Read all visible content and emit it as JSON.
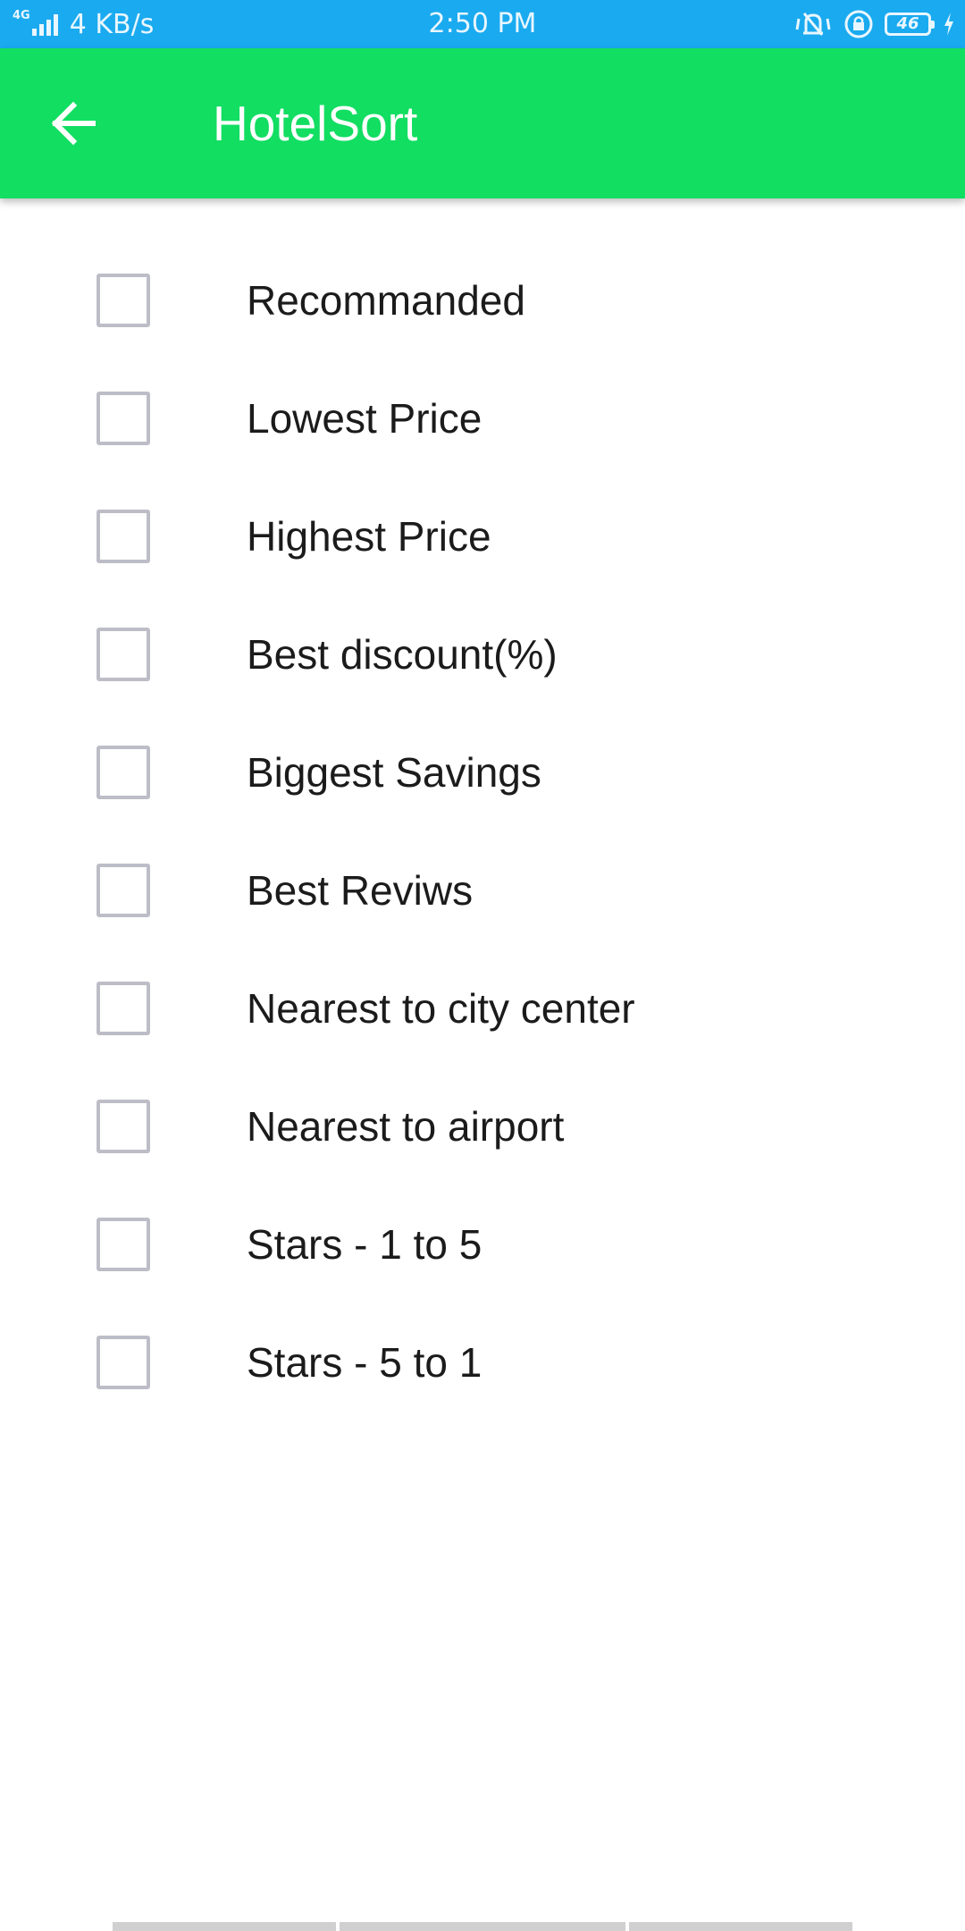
{
  "status_bar": {
    "network_type": "4G",
    "data_speed": "4 KB/s",
    "time": "2:50 PM",
    "battery_level": "46",
    "icons": [
      "signal-icon",
      "vibrate-icon",
      "rotation-lock-icon",
      "battery-icon",
      "charging-icon"
    ]
  },
  "app_bar": {
    "title": "HotelSort",
    "back_icon": "arrow-back-icon",
    "color": "#12de62"
  },
  "sort_options": [
    {
      "label": "Recommanded",
      "checked": false
    },
    {
      "label": "Lowest Price",
      "checked": false
    },
    {
      "label": "Highest Price",
      "checked": false
    },
    {
      "label": "Best discount(%)",
      "checked": false
    },
    {
      "label": "Biggest Savings",
      "checked": false
    },
    {
      "label": "Best Reviws",
      "checked": false
    },
    {
      "label": "Nearest to city center",
      "checked": false
    },
    {
      "label": "Nearest to airport",
      "checked": false
    },
    {
      "label": "Stars - 1 to 5",
      "checked": false
    },
    {
      "label": "Stars - 5 to 1",
      "checked": false
    }
  ],
  "colors": {
    "status_bar": "#1aaaf0",
    "app_bar": "#12de62",
    "checkbox_border": "#bdbdc7",
    "text": "#1b1b1b"
  }
}
